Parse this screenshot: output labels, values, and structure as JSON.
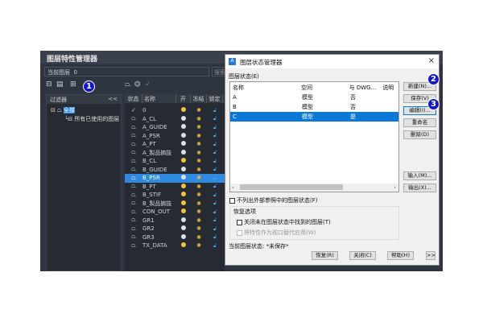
{
  "panel": {
    "title": "图层特性管理器",
    "current_layer_label": "当前图层",
    "current_layer_value": "0",
    "search_placeholder": "搜索"
  },
  "filters": {
    "header": "过滤器",
    "collapse": "<<",
    "tree": [
      {
        "label": "全部"
      },
      {
        "label": "所有已使用的图层"
      }
    ]
  },
  "layer_table": {
    "columns": [
      "状态",
      "名称",
      "开",
      "冻结",
      "锁定"
    ],
    "rows": [
      {
        "name": "0",
        "on": "yellow",
        "current": true
      },
      {
        "name": "A_CL",
        "on": "white"
      },
      {
        "name": "A_GUIDE",
        "on": "white"
      },
      {
        "name": "A_PSR",
        "on": "white"
      },
      {
        "name": "A_PT",
        "on": "white"
      },
      {
        "name": "A_製品掮抜",
        "on": "white"
      },
      {
        "name": "B_CL",
        "on": "yellow"
      },
      {
        "name": "B_GUIDE",
        "on": "white"
      },
      {
        "name": "B_PSR",
        "on": "white",
        "selected": true
      },
      {
        "name": "B_PT",
        "on": "yellow"
      },
      {
        "name": "B_STIF",
        "on": "yellow"
      },
      {
        "name": "B_製品掮抜",
        "on": "yellow"
      },
      {
        "name": "CON_OUT",
        "on": "yellow"
      },
      {
        "name": "GR1",
        "on": "white"
      },
      {
        "name": "GR2",
        "on": "white"
      },
      {
        "name": "GR3",
        "on": "white"
      },
      {
        "name": "TX_DATA",
        "on": "yellow"
      }
    ]
  },
  "dialog": {
    "title": "图层状态管理器",
    "close": "×",
    "list_label": "图层状态(E)",
    "columns": [
      "名称",
      "空间",
      "与 DWG...",
      "说明"
    ],
    "rows": [
      {
        "name": "A",
        "space": "模型",
        "same": "否"
      },
      {
        "name": "B",
        "space": "模型",
        "same": "否"
      },
      {
        "name": "C",
        "space": "模型",
        "same": "是",
        "selected": true
      }
    ],
    "buttons": {
      "new": "新建(N)...",
      "save": "保存(V)",
      "edit": "编辑(I)...",
      "rename": "重命名",
      "delete": "删除(D)",
      "import": "输入(M)...",
      "export": "输出(X)..."
    },
    "hide_xref": "不列出外部参照中的图层状态(F)",
    "restore_group": "恢复选项",
    "turn_off": "关闭未在图层状态中找到的图层(T)",
    "apply_vp": "将特性作为视口替代应用(W)",
    "current_state_label": "当前图层状态:",
    "current_state_value": "*未保存*",
    "footer": {
      "restore": "恢复(R)",
      "close": "关闭(C)",
      "help": "帮助(H)",
      "more": ">>"
    }
  },
  "badges": [
    "1",
    "2",
    "3"
  ],
  "colors": {
    "accent": "#0a78d7",
    "badge": "#1218c8",
    "bulb_yellow": "#f2c23c",
    "bulb_white": "#d8e0ea"
  }
}
